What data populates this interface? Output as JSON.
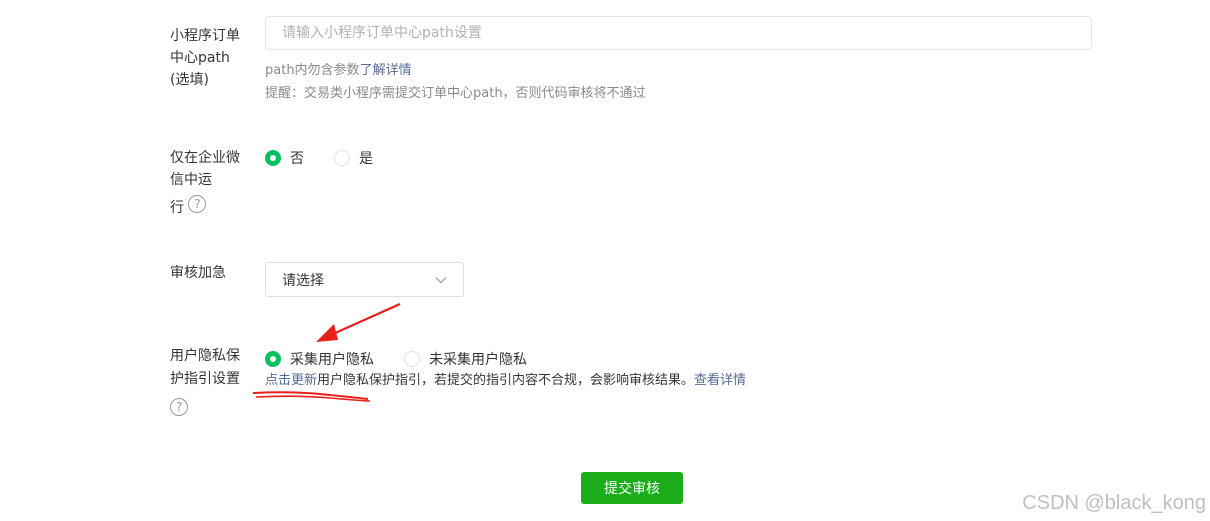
{
  "order_path": {
    "label_lines": [
      "小程序订单",
      "中心path",
      "(选填)"
    ],
    "placeholder": "请输入小程序订单中心path设置",
    "value": "",
    "hint_text": "path内勿含参数",
    "hint_link": "了解详情",
    "reminder": "提醒：交易类小程序需提交订单中心path，否则代码审核将不通过"
  },
  "wecom_only": {
    "label_lines": [
      "仅在企业微",
      "信中运",
      "行"
    ],
    "help": "?",
    "options": [
      "否",
      "是"
    ],
    "selected": "否"
  },
  "urgent": {
    "label": "审核加急",
    "select_value": "请选择"
  },
  "privacy": {
    "label_lines": [
      "用户隐私保",
      "护指引设置"
    ],
    "help": "?",
    "options": [
      "采集用户隐私",
      "未采集用户隐私"
    ],
    "selected": "采集用户隐私",
    "update_link": "点击更新",
    "desc": "用户隐私保护指引，若提交的指引内容不合规，会影响审核结果。",
    "detail_link": "查看详情"
  },
  "submit_label": "提交审核",
  "watermark": "CSDN @black_kong",
  "colors": {
    "primary_green": "#07c160",
    "button_green": "#1aad19",
    "link_blue": "#576b95",
    "annotation_red": "#e8201a"
  }
}
